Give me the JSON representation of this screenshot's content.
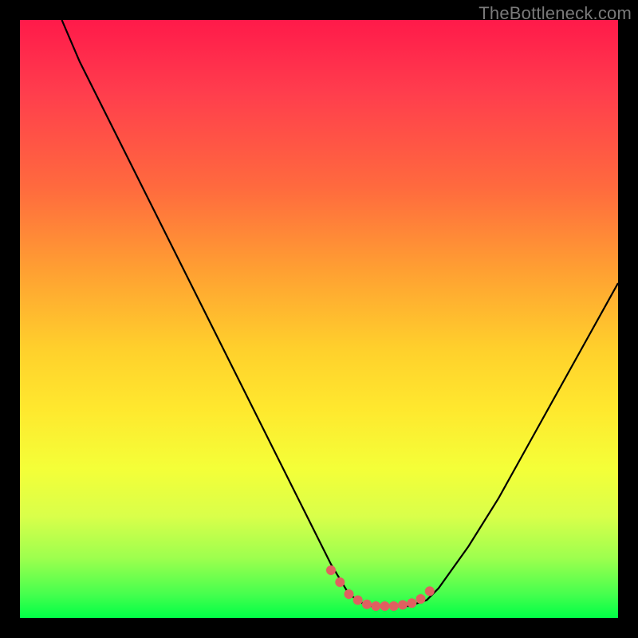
{
  "watermark": "TheBottleneck.com",
  "colors": {
    "background": "#000000",
    "gradient_top": "#ff1a4a",
    "gradient_mid1": "#ff6a3e",
    "gradient_mid2": "#ffd02c",
    "gradient_mid3": "#f4ff38",
    "gradient_bottom": "#00ff46",
    "curve": "#000000",
    "dot": "#e06060"
  },
  "chart_data": {
    "type": "line",
    "title": "",
    "xlabel": "",
    "ylabel": "",
    "xlim": [
      0,
      100
    ],
    "ylim": [
      0,
      100
    ],
    "grid": false,
    "legend_position": "none",
    "series": [
      {
        "name": "curve",
        "x": [
          7,
          10,
          15,
          20,
          25,
          30,
          35,
          40,
          45,
          50,
          52,
          55,
          58,
          60,
          62,
          65,
          68,
          70,
          75,
          80,
          85,
          90,
          95,
          100
        ],
        "values": [
          100,
          93,
          83,
          73,
          63,
          53,
          43,
          33,
          23,
          13,
          9,
          4,
          2,
          2,
          2,
          2,
          3,
          5,
          12,
          20,
          29,
          38,
          47,
          56
        ]
      }
    ],
    "highlighted_points": {
      "name": "valley-dots",
      "x": [
        52,
        53.5,
        55,
        56.5,
        58,
        59.5,
        61,
        62.5,
        64,
        65.5,
        67,
        68.5
      ],
      "values": [
        8,
        6,
        4,
        3,
        2.3,
        2,
        2,
        2,
        2.2,
        2.5,
        3.2,
        4.5
      ]
    }
  }
}
